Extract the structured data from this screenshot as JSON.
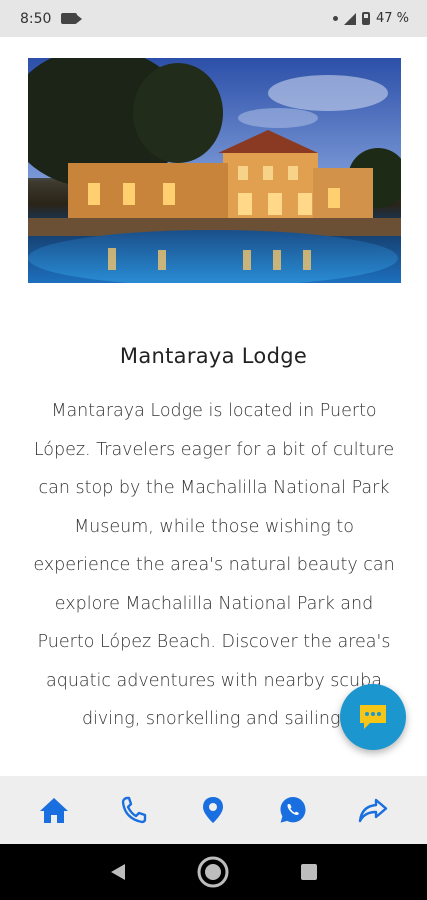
{
  "status_bar": {
    "time": "8:50",
    "battery": "47 %"
  },
  "content": {
    "title": "Mantaraya Lodge",
    "description": "Mantaraya Lodge is located in Puerto López. Travelers eager for a bit of culture can stop by the Machalilla National Park Museum, while those wishing to experience the area's natural beauty can explore Machalilla National Park and Puerto López Beach. Discover the area's aquatic adventures with nearby scuba diving, snorkelling and sailing."
  },
  "bottom_nav": {
    "items": [
      {
        "icon": "home-icon"
      },
      {
        "icon": "phone-icon"
      },
      {
        "icon": "location-pin-icon"
      },
      {
        "icon": "whatsapp-icon"
      },
      {
        "icon": "share-icon"
      }
    ]
  },
  "colors": {
    "nav_icon": "#1a6fe0",
    "fab_bg": "#1b96cf",
    "fab_icon": "#f5c518",
    "nav_bg": "#eeeeee"
  }
}
